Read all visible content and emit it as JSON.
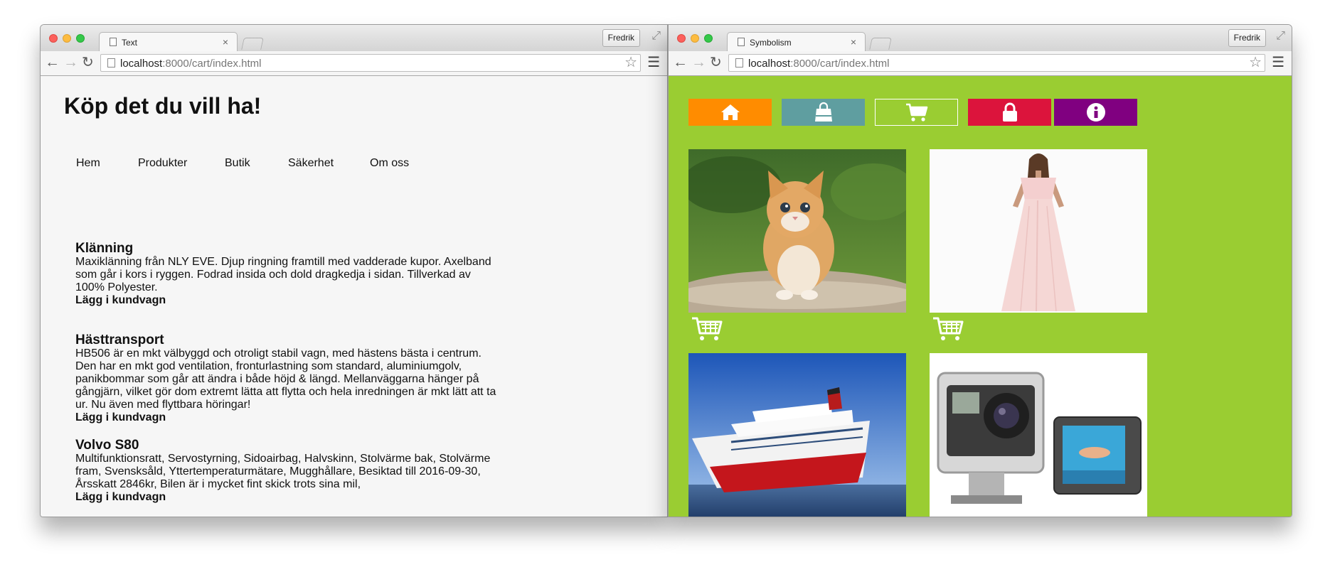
{
  "left": {
    "tab_title": "Text",
    "user": "Fredrik",
    "url_host": "localhost",
    "url_path": ":8000/cart/index.html",
    "title": "Köp det du vill ha!",
    "nav": [
      "Hem",
      "Produkter",
      "Butik",
      "Säkerhet",
      "Om oss"
    ],
    "products": [
      {
        "name": "Klänning",
        "lines": [
          "Maxiklänning från NLY EVE. Djup ringning framtill med vadderade kupor. Axelband",
          "som går i kors i ryggen. Fodrad insida och dold dragkedja i sidan. Tillverkad av",
          "100% Polyester."
        ],
        "add": "Lägg i kundvagn"
      },
      {
        "name": "Hästtransport",
        "lines": [
          "HB506 är en mkt välbyggd och otroligt stabil vagn, med hästens bästa i centrum.",
          "Den har en mkt god ventilation, fronturlastning som standard, aluminiumgolv,",
          "panikbommar som går att ändra i både höjd & längd. Mellanväggarna hänger på",
          "gångjärn, vilket gör dom extremt lätta att flytta och hela inredningen är mkt lätt att ta",
          "ur. Nu även med flyttbara höringar!"
        ],
        "add": "Lägg i kundvagn"
      },
      {
        "name": "Volvo S80",
        "lines": [
          "Multifunktionsratt, Servostyrning, Sidoairbag, Halvskinn, Stolvärme bak, Stolvärme",
          "fram, Svensksåld, Yttertemperaturmätare, Mugghållare, Besiktad till 2016-09-30,",
          "Årsskatt 2846kr, Bilen är i mycket fint skick trots sina mil,"
        ],
        "add": "Lägg i kundvagn"
      }
    ]
  },
  "right": {
    "tab_title": "Symbolism",
    "user": "Fredrik",
    "url_host": "localhost",
    "url_path": ":8000/cart/index.html",
    "nav_icons": [
      {
        "name": "home-icon",
        "color": "#ff8c00"
      },
      {
        "name": "shopping-bag-icon",
        "color": "#5f9ea0"
      },
      {
        "name": "cart-icon",
        "color": "#9acd32"
      },
      {
        "name": "lock-icon",
        "color": "#dc143c"
      },
      {
        "name": "info-icon",
        "color": "#800080"
      }
    ],
    "tiles": [
      "kitten",
      "pink-dress",
      "cruise-ship",
      "action-camera"
    ]
  },
  "colors": {
    "page_green": "#9acd32",
    "left_bg": "#f6f6f6"
  }
}
